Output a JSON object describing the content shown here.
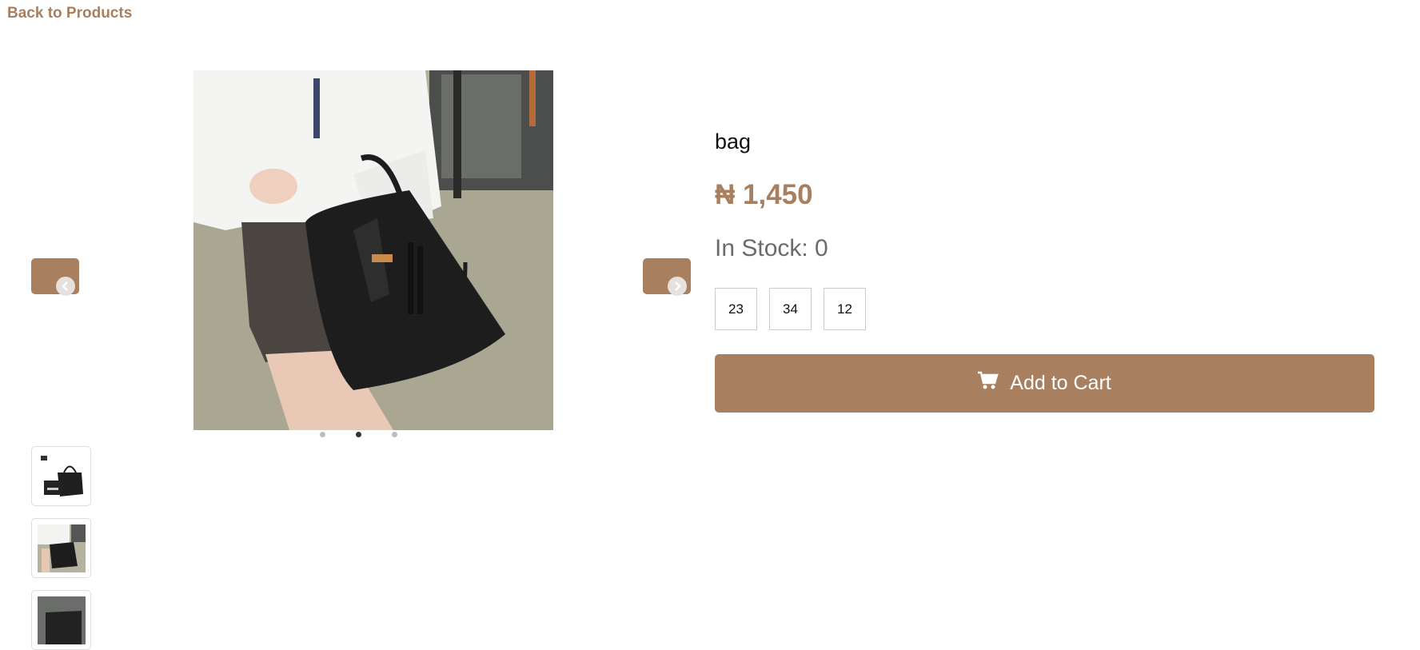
{
  "nav": {
    "back_label": "Back to Products"
  },
  "product": {
    "name": "bag",
    "price": "₦ 1,450",
    "stock": "In Stock: 0",
    "sizes": [
      "23",
      "34",
      "12"
    ],
    "add_to_cart_label": "Add to Cart"
  },
  "carousel": {
    "slide_count": 3,
    "active_slide": 2,
    "prev_icon": "chevron-left-icon",
    "next_icon": "chevron-right-icon"
  },
  "thumbnails": [
    {
      "alt": "bag set"
    },
    {
      "alt": "bag worn"
    },
    {
      "alt": "bag closeup"
    }
  ],
  "colors": {
    "accent": "#a87f5f",
    "stock_text": "#6b6b6b"
  }
}
